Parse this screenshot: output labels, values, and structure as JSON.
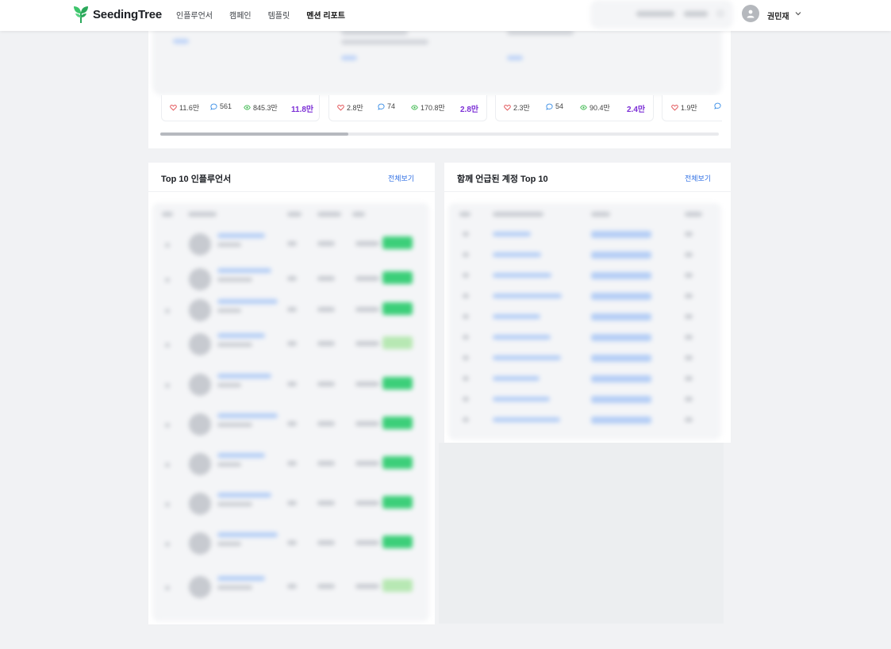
{
  "header": {
    "logo_text": "SeedingTree",
    "nav": [
      "인플루언서",
      "캠페인",
      "템플릿",
      "멘션 리포트"
    ],
    "active_nav_index": 3,
    "user_name": "권민재"
  },
  "posts": [
    {
      "likes": "11.6만",
      "comments": "561",
      "views": "845.3만",
      "total": "11.8만"
    },
    {
      "likes": "2.8만",
      "comments": "74",
      "views": "170.8만",
      "total": "2.8만"
    },
    {
      "likes": "2.3만",
      "comments": "54",
      "views": "90.4만",
      "total": "2.4만"
    },
    {
      "likes": "1.9만"
    }
  ],
  "top_influencers": {
    "title": "Top 10 인플루언서",
    "link": "전체보기"
  },
  "mentioned_accounts": {
    "title": "함께 언급된 계정 Top 10",
    "link": "전체보기"
  },
  "colors": {
    "accent_purple": "#7c2fd6",
    "link_blue": "#2f6fe4",
    "heart_red": "#e0474c",
    "comment_blue": "#3a8ee6",
    "view_green": "#3fb950",
    "badge_green": "#3ccf79"
  }
}
